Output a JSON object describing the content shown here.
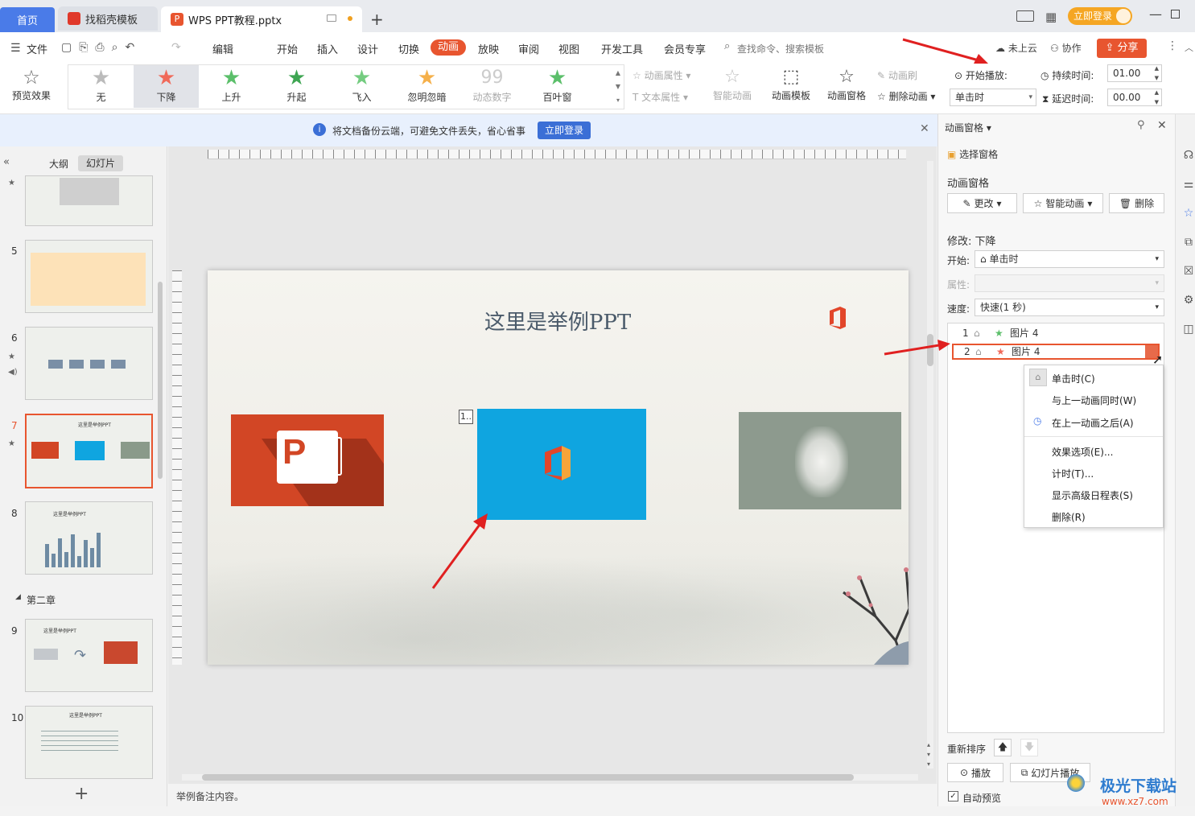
{
  "tabs": {
    "home": "首页",
    "docer": "找稻壳模板",
    "document": "WPS PPT教程.pptx"
  },
  "titlebar": {
    "login_button": "立即登录"
  },
  "menu": {
    "file": "文件",
    "edit": "编辑",
    "items": [
      "开始",
      "插入",
      "设计",
      "切换",
      "动画",
      "放映",
      "审阅",
      "视图",
      "开发工具",
      "会员专享"
    ],
    "search_placeholder": "查找命令、搜索模板",
    "cloud": "未上云",
    "collab": "协作",
    "share": "分享"
  },
  "ribbon": {
    "preview": "预览效果",
    "effects": [
      "无",
      "下降",
      "上升",
      "升起",
      "飞入",
      "忽明忽暗",
      "动态数字",
      "百叶窗"
    ],
    "anim_props": "动画属性",
    "text_props": "文本属性",
    "smart_anim": "智能动画",
    "anim_template": "动画模板",
    "anim_pane": "动画窗格",
    "anim_brush": "动画刷",
    "delete_anim": "删除动画",
    "start_label": "开始播放:",
    "start_value": "单击时",
    "duration_label": "持续时间:",
    "duration_value": "01.00",
    "delay_label": "延迟时间:",
    "delay_value": "00.00"
  },
  "notify": {
    "text": "将文档备份云端，可避免文件丢失，省心省事",
    "button": "立即登录"
  },
  "leftpanel": {
    "outline": "大纲",
    "slides": "幻灯片",
    "section": "第二章",
    "slide_numbers": [
      "5",
      "6",
      "7",
      "8",
      "9",
      "10"
    ],
    "thumb_title": "这里是举例PPT"
  },
  "slide": {
    "title": "这里是举例PPT",
    "anim_tag": "1.."
  },
  "notes": "举例备注内容。",
  "rpane": {
    "header": "动画窗格",
    "select_pane": "选择窗格",
    "section_title": "动画窗格",
    "change": "更改",
    "smart": "智能动画",
    "delete": "删除",
    "modify": "修改: 下降",
    "start_label": "开始:",
    "start_value": "单击时",
    "attr_label": "属性:",
    "speed_label": "速度:",
    "speed_value": "快速(1 秒)",
    "list": [
      {
        "num": "1",
        "name": "图片 4"
      },
      {
        "num": "2",
        "name": "图片 4"
      }
    ],
    "reorder": "重新排序",
    "play": "播放",
    "slideshow": "幻灯片播放",
    "autopreview": "自动预览"
  },
  "context_menu": [
    "单击时(C)",
    "与上一动画同时(W)",
    "在上一动画之后(A)",
    "效果选项(E)...",
    "计时(T)...",
    "显示高级日程表(S)",
    "删除(R)"
  ],
  "watermark": {
    "brand": "极光下载站",
    "url": "www.xz7.com"
  },
  "colors": {
    "accent": "#e8552f",
    "blue": "#4a7be8",
    "ppt_red": "#d24625",
    "office_blue": "#0fa5e0"
  }
}
